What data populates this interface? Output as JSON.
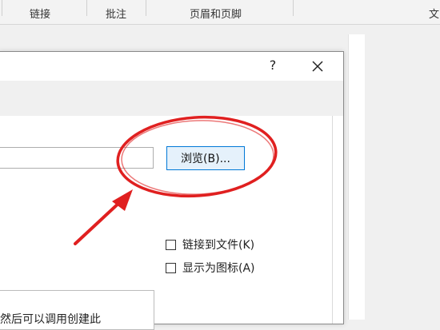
{
  "ribbon": {
    "items": [
      "链接",
      "批注",
      "页眉和页脚",
      "文"
    ]
  },
  "dialog": {
    "help_label": "?",
    "browse_label": "浏览(B)...",
    "checkbox_link_label": "链接到文件(K)",
    "checkbox_icon_label": "显示为图标(A)",
    "result_text": "然后可以调用创建此"
  },
  "annotation": {
    "color": "#e02020"
  }
}
